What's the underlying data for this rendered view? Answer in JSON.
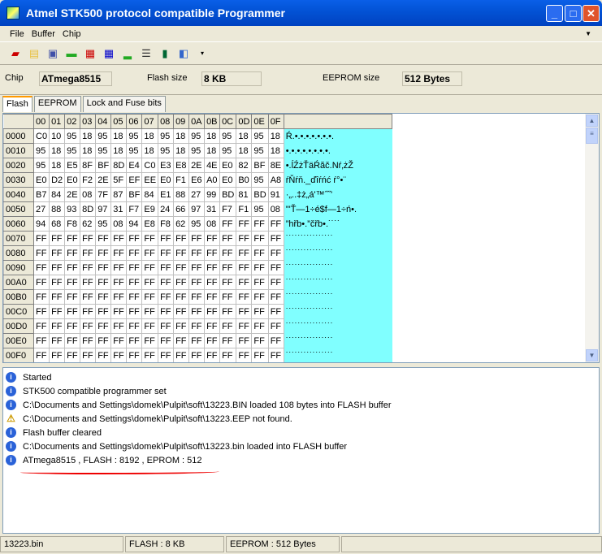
{
  "window": {
    "title": "Atmel STK500 protocol compatible Programmer"
  },
  "menu": [
    "File",
    "Buffer",
    "Chip"
  ],
  "toolbar": [
    "erase-icon",
    "open-icon",
    "save-icon",
    "read-chip-icon",
    "program-flash-icon",
    "verify-flash-icon",
    "chip-icon",
    "read-eeprom-icon",
    "lock-chip-icon",
    "exit-icon"
  ],
  "info": {
    "chip_label": "Chip",
    "chip": "ATmega8515",
    "flash_label": "Flash size",
    "flash": "8 KB",
    "eeprom_label": "EEPROM size",
    "eeprom": "512 Bytes"
  },
  "tabs": [
    "Flash",
    "EEPROM",
    "Lock and Fuse bits"
  ],
  "grid": {
    "columns": [
      "00",
      "01",
      "02",
      "03",
      "04",
      "05",
      "06",
      "07",
      "08",
      "09",
      "0A",
      "0B",
      "0C",
      "0D",
      "0E",
      "0F"
    ],
    "rows": [
      {
        "addr": "0000",
        "bytes": [
          "C0",
          "10",
          "95",
          "18",
          "95",
          "18",
          "95",
          "18",
          "95",
          "18",
          "95",
          "18",
          "95",
          "18",
          "95",
          "18"
        ],
        "ascii": "Ŕ.•.•.•.•.•.•.•."
      },
      {
        "addr": "0010",
        "bytes": [
          "95",
          "18",
          "95",
          "18",
          "95",
          "18",
          "95",
          "18",
          "95",
          "18",
          "95",
          "18",
          "95",
          "18",
          "95",
          "18"
        ],
        "ascii": "•.•.•.•.•.•.•.•."
      },
      {
        "addr": "0020",
        "bytes": [
          "95",
          "18",
          "E5",
          "8F",
          "BF",
          "8D",
          "E4",
          "C0",
          "E3",
          "E8",
          "2E",
          "4E",
          "E0",
          "82",
          "BF",
          "8E"
        ],
        "ascii": "•.ĺŹżŤäŔăč.Nŕ‚żŽ"
      },
      {
        "addr": "0030",
        "bytes": [
          "E0",
          "D2",
          "E0",
          "F2",
          "2E",
          "5F",
          "EF",
          "EE",
          "E0",
          "F1",
          "E6",
          "A0",
          "E0",
          "B0",
          "95",
          "A8"
        ],
        "ascii": "ŕŇŕň._ďîŕńć ŕ°•¨"
      },
      {
        "addr": "0040",
        "bytes": [
          "B7",
          "84",
          "2E",
          "08",
          "7F",
          "87",
          "BF",
          "84",
          "E1",
          "88",
          "27",
          "99",
          "BD",
          "81",
          "BD",
          "91"
        ],
        "ascii": "·„..‡ż„á'™˝˝'"
      },
      {
        "addr": "0050",
        "bytes": [
          "27",
          "88",
          "93",
          "8D",
          "97",
          "31",
          "F7",
          "E9",
          "24",
          "66",
          "97",
          "31",
          "F7",
          "F1",
          "95",
          "08"
        ],
        "ascii": "'\"Ť—1÷é$f—1÷ń•."
      },
      {
        "addr": "0060",
        "bytes": [
          "94",
          "68",
          "F8",
          "62",
          "95",
          "08",
          "94",
          "E8",
          "F8",
          "62",
          "95",
          "08",
          "FF",
          "FF",
          "FF",
          "FF"
        ],
        "ascii": "”hřb•.”čřb•.˙˙˙˙"
      },
      {
        "addr": "0070",
        "bytes": [
          "FF",
          "FF",
          "FF",
          "FF",
          "FF",
          "FF",
          "FF",
          "FF",
          "FF",
          "FF",
          "FF",
          "FF",
          "FF",
          "FF",
          "FF",
          "FF"
        ],
        "ascii": "˙˙˙˙˙˙˙˙˙˙˙˙˙˙˙˙"
      },
      {
        "addr": "0080",
        "bytes": [
          "FF",
          "FF",
          "FF",
          "FF",
          "FF",
          "FF",
          "FF",
          "FF",
          "FF",
          "FF",
          "FF",
          "FF",
          "FF",
          "FF",
          "FF",
          "FF"
        ],
        "ascii": "˙˙˙˙˙˙˙˙˙˙˙˙˙˙˙˙"
      },
      {
        "addr": "0090",
        "bytes": [
          "FF",
          "FF",
          "FF",
          "FF",
          "FF",
          "FF",
          "FF",
          "FF",
          "FF",
          "FF",
          "FF",
          "FF",
          "FF",
          "FF",
          "FF",
          "FF"
        ],
        "ascii": "˙˙˙˙˙˙˙˙˙˙˙˙˙˙˙˙"
      },
      {
        "addr": "00A0",
        "bytes": [
          "FF",
          "FF",
          "FF",
          "FF",
          "FF",
          "FF",
          "FF",
          "FF",
          "FF",
          "FF",
          "FF",
          "FF",
          "FF",
          "FF",
          "FF",
          "FF"
        ],
        "ascii": "˙˙˙˙˙˙˙˙˙˙˙˙˙˙˙˙"
      },
      {
        "addr": "00B0",
        "bytes": [
          "FF",
          "FF",
          "FF",
          "FF",
          "FF",
          "FF",
          "FF",
          "FF",
          "FF",
          "FF",
          "FF",
          "FF",
          "FF",
          "FF",
          "FF",
          "FF"
        ],
        "ascii": "˙˙˙˙˙˙˙˙˙˙˙˙˙˙˙˙"
      },
      {
        "addr": "00C0",
        "bytes": [
          "FF",
          "FF",
          "FF",
          "FF",
          "FF",
          "FF",
          "FF",
          "FF",
          "FF",
          "FF",
          "FF",
          "FF",
          "FF",
          "FF",
          "FF",
          "FF"
        ],
        "ascii": "˙˙˙˙˙˙˙˙˙˙˙˙˙˙˙˙"
      },
      {
        "addr": "00D0",
        "bytes": [
          "FF",
          "FF",
          "FF",
          "FF",
          "FF",
          "FF",
          "FF",
          "FF",
          "FF",
          "FF",
          "FF",
          "FF",
          "FF",
          "FF",
          "FF",
          "FF"
        ],
        "ascii": "˙˙˙˙˙˙˙˙˙˙˙˙˙˙˙˙"
      },
      {
        "addr": "00E0",
        "bytes": [
          "FF",
          "FF",
          "FF",
          "FF",
          "FF",
          "FF",
          "FF",
          "FF",
          "FF",
          "FF",
          "FF",
          "FF",
          "FF",
          "FF",
          "FF",
          "FF"
        ],
        "ascii": "˙˙˙˙˙˙˙˙˙˙˙˙˙˙˙˙"
      },
      {
        "addr": "00F0",
        "bytes": [
          "FF",
          "FF",
          "FF",
          "FF",
          "FF",
          "FF",
          "FF",
          "FF",
          "FF",
          "FF",
          "FF",
          "FF",
          "FF",
          "FF",
          "FF",
          "FF"
        ],
        "ascii": "˙˙˙˙˙˙˙˙˙˙˙˙˙˙˙˙"
      }
    ]
  },
  "log": [
    {
      "type": "info",
      "text": "Started"
    },
    {
      "type": "info",
      "text": "STK500 compatible programmer set"
    },
    {
      "type": "info",
      "text": "C:\\Documents and Settings\\domek\\Pulpit\\soft\\13223.BIN loaded 108 bytes into FLASH buffer"
    },
    {
      "type": "warning",
      "text": "C:\\Documents and Settings\\domek\\Pulpit\\soft\\13223.EEP not found."
    },
    {
      "type": "info",
      "text": "Flash buffer cleared"
    },
    {
      "type": "info",
      "text": "C:\\Documents and Settings\\domek\\Pulpit\\soft\\13223.bin loaded into FLASH buffer"
    },
    {
      "type": "info",
      "text": "ATmega8515 , FLASH : 8192 , EPROM : 512"
    }
  ],
  "status": [
    "13223.bin",
    "FLASH : 8 KB",
    "EEPROM : 512 Bytes"
  ]
}
